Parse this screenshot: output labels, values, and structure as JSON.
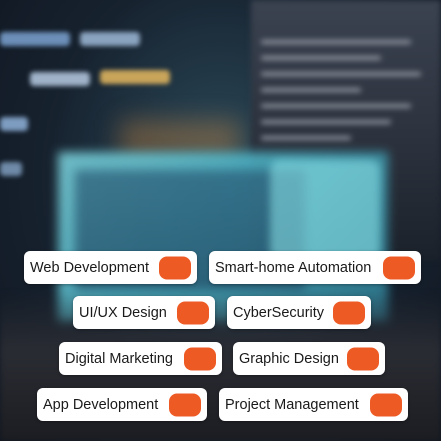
{
  "colors": {
    "chip_background": "#ffffff",
    "toggle_accent": "#ee5a24",
    "label_text": "#1a1a1a"
  },
  "chips": [
    {
      "label": "Web Development",
      "selected": true
    },
    {
      "label": "Smart-home Automation",
      "selected": true
    },
    {
      "label": "UI/UX Design",
      "selected": true
    },
    {
      "label": "CyberSecurity",
      "selected": true
    },
    {
      "label": "Digital Marketing",
      "selected": true
    },
    {
      "label": "Graphic Design",
      "selected": true
    },
    {
      "label": "App Development",
      "selected": true
    },
    {
      "label": "Project Management",
      "selected": true
    }
  ]
}
